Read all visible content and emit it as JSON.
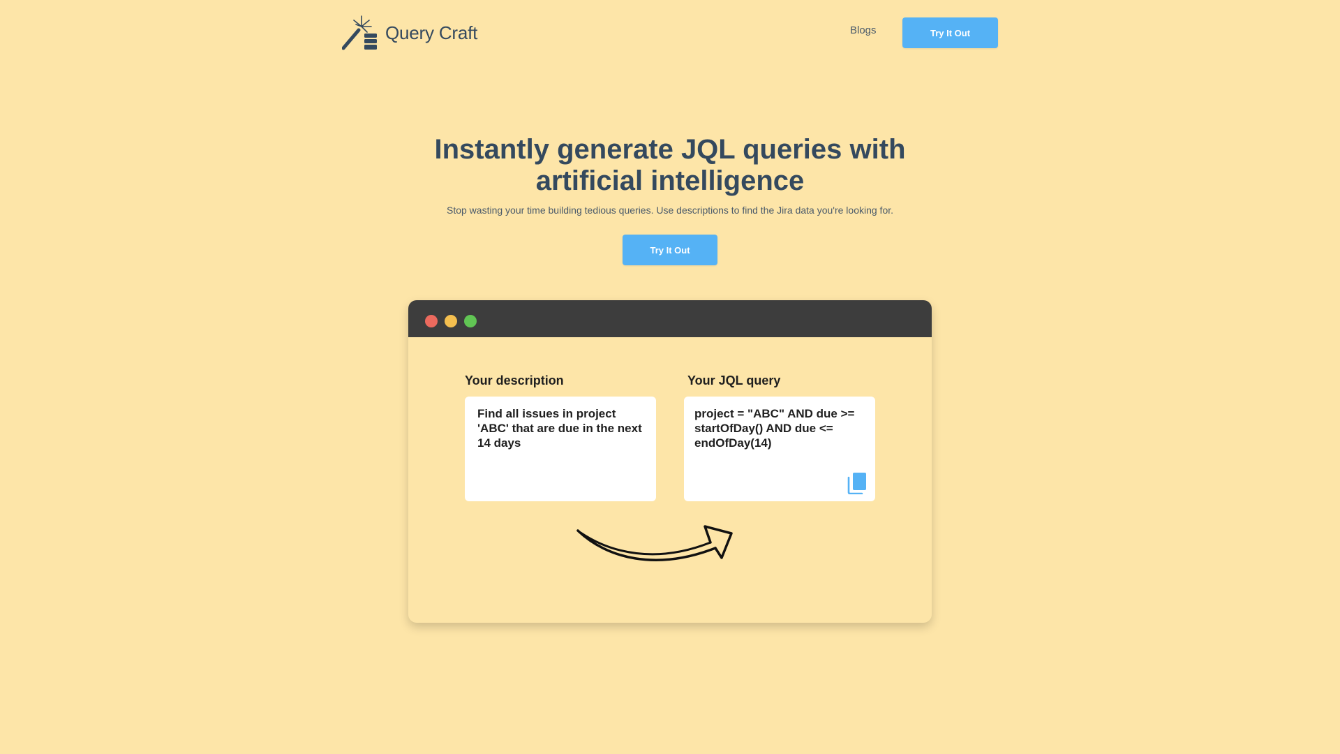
{
  "header": {
    "logo_text": "Query Craft",
    "nav_blogs": "Blogs",
    "cta_label": "Try It Out"
  },
  "hero": {
    "title_line1": "Instantly generate JQL queries with",
    "title_line2": "artificial intelligence",
    "subtitle": "Stop wasting your time building tedious queries. Use descriptions to find the Jira data you're looking for.",
    "cta_label": "Try It Out"
  },
  "demo": {
    "description_label": "Your description",
    "description_text": "Find all issues in project 'ABC' that are due in the next 14 days",
    "jql_label": "Your JQL query",
    "jql_text": "project = \"ABC\" AND due >= startOfDay() AND due <= endOfDay(14)"
  },
  "colors": {
    "background": "#fde5a8",
    "accent": "#55b2f5",
    "heading": "#34495e",
    "window_bar": "#3d3d3d",
    "dot_red": "#ec6a5e",
    "dot_yellow": "#f4bf4f",
    "dot_green": "#61c554"
  },
  "icons": {
    "logo": "magic-wand-database-icon",
    "copy": "copy-icon",
    "arrow": "curved-arrow-icon"
  }
}
